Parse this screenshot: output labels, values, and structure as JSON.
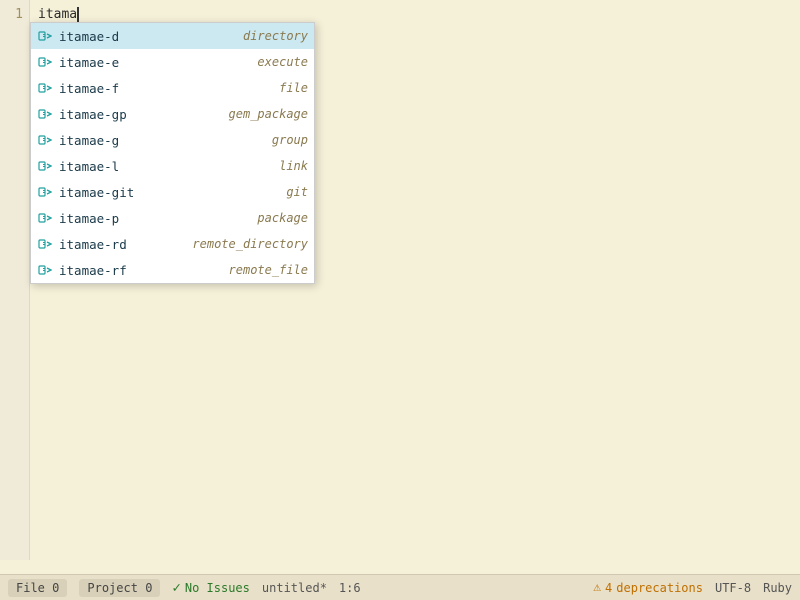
{
  "editor": {
    "typed_text": "itama",
    "background_color": "#f5f0d8",
    "line_number": "1"
  },
  "autocomplete": {
    "items": [
      {
        "name": "itamae-d",
        "type": "directory",
        "icon": "snippet"
      },
      {
        "name": "itamae-e",
        "type": "execute",
        "icon": "snippet"
      },
      {
        "name": "itamae-f",
        "type": "file",
        "icon": "snippet"
      },
      {
        "name": "itamae-gp",
        "type": "gem_package",
        "icon": "snippet"
      },
      {
        "name": "itamae-g",
        "type": "group",
        "icon": "snippet"
      },
      {
        "name": "itamae-l",
        "type": "link",
        "icon": "snippet"
      },
      {
        "name": "itamae-git",
        "type": "git",
        "icon": "snippet"
      },
      {
        "name": "itamae-p",
        "type": "package",
        "icon": "snippet"
      },
      {
        "name": "itamae-rd",
        "type": "remote_directory",
        "icon": "snippet"
      },
      {
        "name": "itamae-rf",
        "type": "remote_file",
        "icon": "snippet"
      }
    ]
  },
  "status_bar": {
    "file_label": "File",
    "file_count": "0",
    "project_label": "Project",
    "project_count": "0",
    "no_issues_label": "No Issues",
    "filename": "untitled*",
    "cursor_position": "1:6",
    "deprecations_count": "4",
    "deprecations_label": "deprecations",
    "encoding": "UTF-8",
    "language": "Ruby"
  }
}
